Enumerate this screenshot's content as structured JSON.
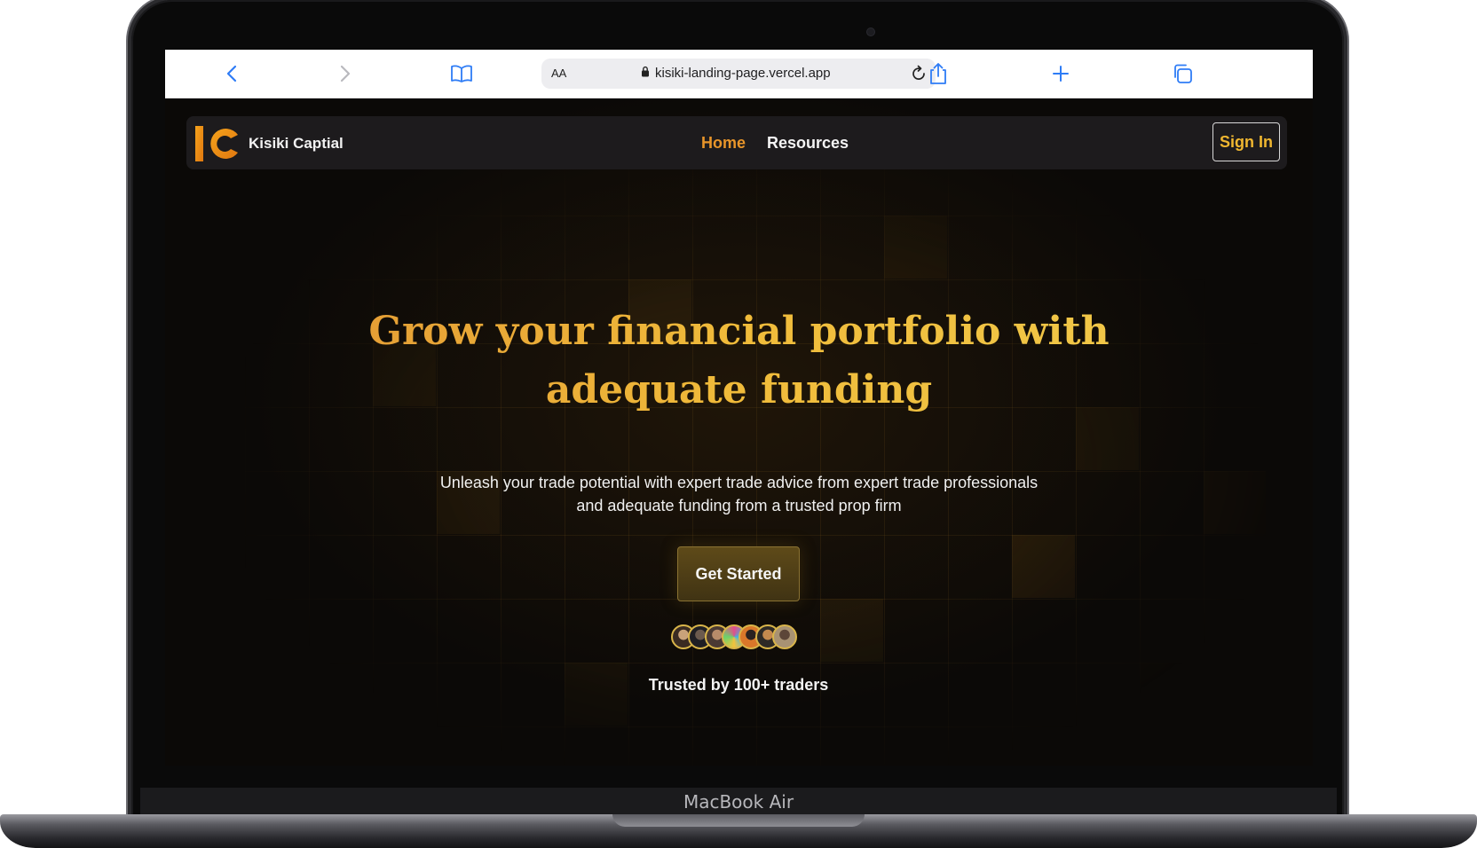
{
  "device": {
    "label": "MacBook Air"
  },
  "browser": {
    "text_size_label": "AA",
    "url": "kisiki-landing-page.vercel.app",
    "icons": [
      "back-icon",
      "forward-icon",
      "bookmarks-icon",
      "lock-icon",
      "reload-icon",
      "share-icon",
      "new-tab-icon",
      "tabs-icon"
    ]
  },
  "navbar": {
    "brand_name": "Kisiki Captial",
    "links": [
      {
        "label": "Home",
        "active": true
      },
      {
        "label": "Resources",
        "active": false
      }
    ],
    "sign_in_label": "Sign In"
  },
  "hero": {
    "title_line1": "Grow your financial portfolio with",
    "title_line2": "adequate funding",
    "subtitle_line1": "Unleash your trade potential with expert trade advice from expert trade professionals",
    "subtitle_line2": "and adequate funding from a trusted prop firm",
    "cta_label": "Get Started",
    "trusted_text": "Trusted by 100+ traders",
    "avatar_count": 7
  },
  "colors": {
    "accent": "#e8952a",
    "gold": "#f0b730",
    "page_bg": "#0b0907",
    "navbar_bg": "#1d1b1d"
  }
}
